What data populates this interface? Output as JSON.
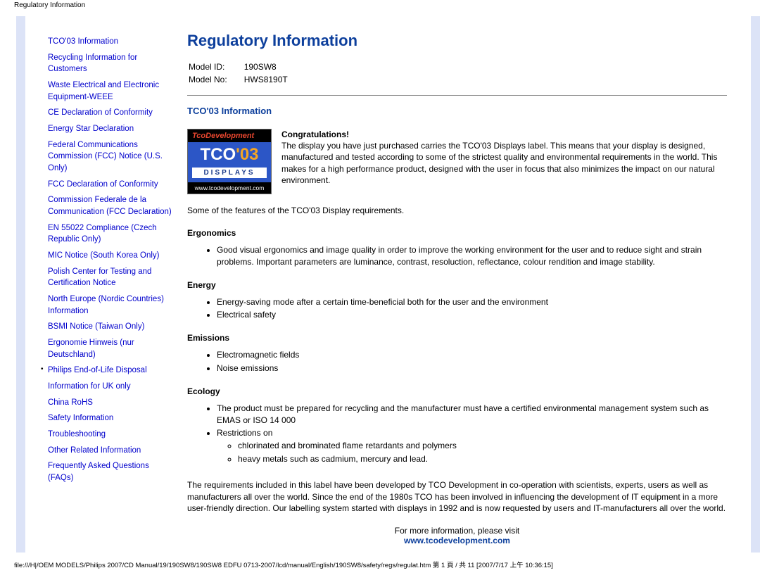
{
  "header_path": "Regulatory Information",
  "sidebar": {
    "items": [
      {
        "label": "TCO'03 Information",
        "bullet": false
      },
      {
        "label": "Recycling Information for Customers",
        "bullet": false
      },
      {
        "label": "Waste Electrical and Electronic Equipment-WEEE",
        "bullet": false
      },
      {
        "label": "CE Declaration of Conformity",
        "bullet": false
      },
      {
        "label": "Energy Star Declaration",
        "bullet": false
      },
      {
        "label": "Federal Communications Commission (FCC) Notice (U.S. Only)",
        "bullet": false
      },
      {
        "label": "FCC Declaration of Conformity",
        "bullet": false
      },
      {
        "label": "Commission Federale de la Communication (FCC Declaration)",
        "bullet": false
      },
      {
        "label": "EN 55022 Compliance (Czech Republic Only)",
        "bullet": false
      },
      {
        "label": "MIC Notice (South Korea Only)",
        "bullet": false
      },
      {
        "label": "Polish Center for Testing and Certification Notice",
        "bullet": false
      },
      {
        "label": "North Europe (Nordic Countries) Information",
        "bullet": false
      },
      {
        "label": "BSMI Notice (Taiwan Only)",
        "bullet": false
      },
      {
        "label": "Ergonomie Hinweis (nur Deutschland)",
        "bullet": false
      },
      {
        "label": "Philips End-of-Life Disposal",
        "bullet": true
      },
      {
        "label": "Information for UK only",
        "bullet": false
      },
      {
        "label": "China RoHS",
        "bullet": false
      },
      {
        "label": "Safety Information",
        "bullet": false
      },
      {
        "label": "Troubleshooting",
        "bullet": false
      },
      {
        "label": "Other Related Information",
        "bullet": false
      },
      {
        "label": "Frequently Asked Questions (FAQs)",
        "bullet": false
      }
    ]
  },
  "main": {
    "title": "Regulatory Information",
    "model_id_label": "Model ID:",
    "model_id_value": "190SW8",
    "model_no_label": "Model No:",
    "model_no_value": "HWS8190T",
    "section_title": "TCO'03 Information",
    "badge": {
      "top": "TcoDevelopment",
      "tco": "TCO",
      "year": "'03",
      "displays": "DISPLAYS",
      "url": "www.tcodevelopment.com"
    },
    "congrats_head": "Congratulations!",
    "congrats_body": "The display you have just purchased carries the TCO'03 Displays label. This means that your display is designed, manufactured and tested according to some of the strictest quality and environmental requirements in the world. This makes for a high performance product, designed with the user in focus that also minimizes the impact on our natural environment.",
    "features_intro": "Some of the features of the TCO'03 Display requirements.",
    "ergonomics": {
      "head": "Ergonomics",
      "items": [
        "Good visual ergonomics and image quality in order to improve the working environment for the user and to reduce sight and strain problems. Important parameters are luminance, contrast, resoluction, reflectance, colour rendition and image stability."
      ]
    },
    "energy": {
      "head": "Energy",
      "items": [
        "Energy-saving mode after a certain time-beneficial both for the user and the environment",
        "Electrical safety"
      ]
    },
    "emissions": {
      "head": "Emissions",
      "items": [
        "Electromagnetic fields",
        "Noise emissions"
      ]
    },
    "ecology": {
      "head": "Ecology",
      "items": [
        "The product must be prepared for recycling and the manufacturer must have a certified environmental management system such as EMAS or ISO 14 000",
        "Restrictions on"
      ],
      "sub": [
        "chlorinated and brominated flame retardants and polymers",
        "heavy metals such as cadmium, mercury and lead."
      ]
    },
    "requirements": "The requirements included in this label have been developed by TCO Development in co-operation with scientists, experts, users as well as manufacturers all over the world. Since the end of the 1980s TCO has been involved in influencing the development of IT equipment in a more user-friendly direction. Our labelling system started with displays in 1992 and is now requested by users and IT-manufacturers all over the world.",
    "more_info": "For more information, please visit",
    "more_info_url": "www.tcodevelopment.com"
  },
  "footer": "file:///H|/OEM MODELS/Philips 2007/CD Manual/19/190SW8/190SW8 EDFU 0713-2007/lcd/manual/English/190SW8/safety/regs/regulat.htm 第 1 頁 / 共 11  [2007/7/17 上午 10:36:15]"
}
